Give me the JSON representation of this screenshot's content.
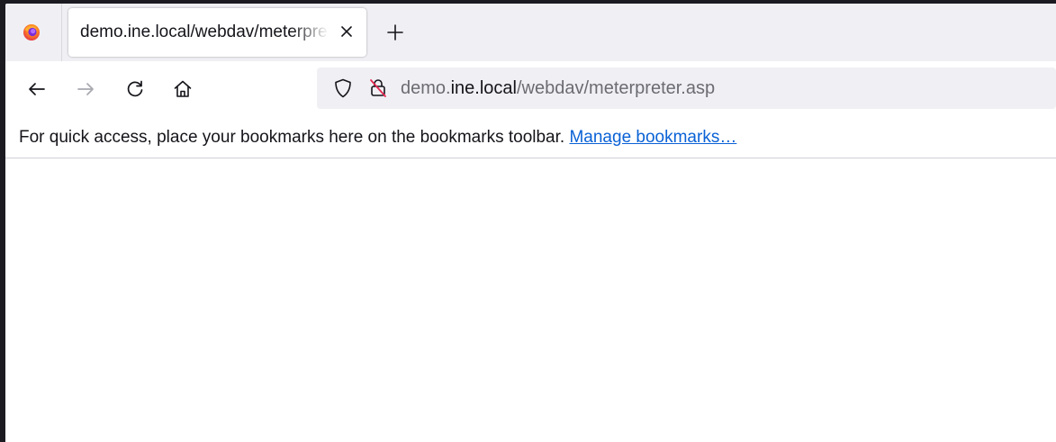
{
  "tab": {
    "title": "demo.ine.local/webdav/meterpreter.asp"
  },
  "urlbar": {
    "prefix": "demo.",
    "domain": "ine.local",
    "path": "/webdav/meterpreter.asp"
  },
  "bookmarks_bar": {
    "message": "For quick access, place your bookmarks here on the bookmarks toolbar.",
    "link_label": "Manage bookmarks…"
  },
  "icons": {
    "firefox": "firefox-icon",
    "close": "close-icon",
    "new_tab": "plus-icon",
    "back": "back-arrow-icon",
    "forward": "forward-arrow-icon",
    "reload": "reload-icon",
    "home": "home-icon",
    "tracking_protection": "shield-icon",
    "insecure": "insecure-lock-icon"
  },
  "colors": {
    "link": "#0a62d6",
    "chrome_bg": "#f0f0f4",
    "frame_bg": "#1c1b22"
  }
}
